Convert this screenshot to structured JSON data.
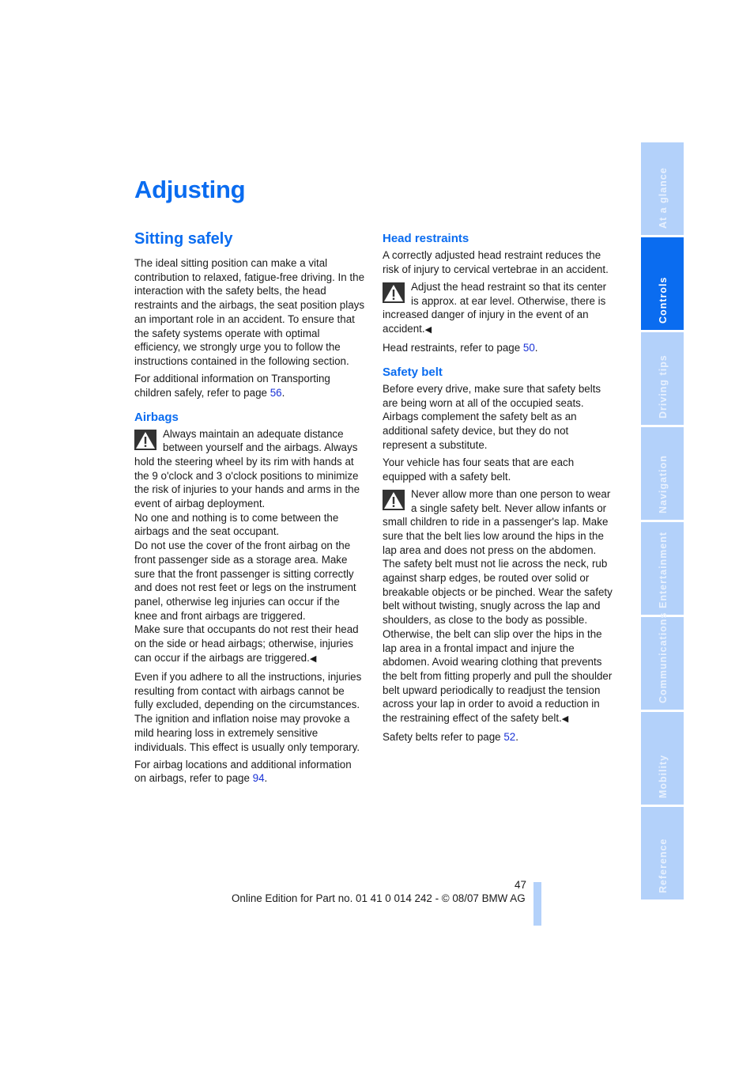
{
  "page": {
    "title": "Adjusting",
    "page_number": "47",
    "footer": "Online Edition for Part no. 01 41 0 014 242 - © 08/07 BMW AG"
  },
  "colors": {
    "accent": "#0a6cf0",
    "tab_inactive": "#b3d1fa",
    "link": "#1a33d6"
  },
  "left_column": {
    "heading": "Sitting safely",
    "intro": "The ideal sitting position can make a vital contribution to relaxed, fatigue-free driving. In the interaction with the safety belts, the head restraints and the airbags, the seat position plays an important role in an accident. To ensure that the safety systems operate with optimal efficiency, we strongly urge you to follow the instructions contained in the following section.",
    "child_ref": {
      "text": "For additional information on Transporting children safely, refer to page ",
      "page": "56",
      "suffix": "."
    },
    "airbags": {
      "heading": "Airbags",
      "warning_p1": "Always maintain an adequate distance between yourself and the airbags. Always hold the steering wheel by its rim with hands at the 9 o'clock and 3 o'clock positions to minimize the risk of injuries to your hands and arms in the event of airbag deployment.",
      "warning_p2": "No one and nothing is to come between the airbags and the seat occupant.",
      "warning_p3": "Do not use the cover of the front airbag on the front passenger side as a storage area. Make sure that the front passenger is sitting correctly and does not rest feet or legs on the instrument panel, otherwise leg injuries can occur if the knee and front airbags are triggered.",
      "warning_p4": "Make sure that occupants do not rest their head on the side or head airbags; otherwise, injuries can occur if the airbags are triggered.",
      "end_mark": "◀",
      "note": "Even if you adhere to all the instructions, injuries resulting from contact with airbags cannot be fully excluded, depending on the circumstances. The ignition and inflation noise may provoke a mild hearing loss in extremely sensitive individuals. This effect is usually only temporary.",
      "ref": {
        "text": "For airbag locations and additional information on airbags, refer to page ",
        "page": "94",
        "suffix": "."
      }
    }
  },
  "right_column": {
    "head_restraints": {
      "heading": "Head restraints",
      "intro": "A correctly adjusted head restraint reduces the risk of injury to cervical vertebrae in an accident.",
      "warning": "Adjust the head restraint so that its center is approx. at ear level. Otherwise, there is increased danger of injury in the event of an accident.",
      "end_mark": "◀",
      "ref": {
        "text": "Head restraints, refer to page ",
        "page": "50",
        "suffix": "."
      }
    },
    "safety_belt": {
      "heading": "Safety belt",
      "p1": "Before every drive, make sure that safety belts are being worn at all of the occupied seats. Airbags complement the safety belt as an additional safety device, but they do not represent a substitute.",
      "p2": "Your vehicle has four seats that are each equipped with a safety belt.",
      "warning": "Never allow more than one person to wear a single safety belt. Never allow infants or small children to ride in a passenger's lap. Make sure that the belt lies low around the hips in the lap area and does not press on the abdomen. The safety belt must not lie across the neck, rub against sharp edges, be routed over solid or breakable objects or be pinched. Wear the safety belt without twisting, snugly across the lap and shoulders, as close to the body as possible. Otherwise, the belt can slip over the hips in the lap area in a frontal impact and injure the abdomen. Avoid wearing clothing that prevents the belt from fitting properly and pull the shoulder belt upward periodically to readjust the tension across your lap in order to avoid a reduction in the restraining effect of the safety belt.",
      "end_mark": "◀",
      "ref": {
        "text": "Safety belts refer to page ",
        "page": "52",
        "suffix": "."
      }
    }
  },
  "side_tabs": [
    {
      "label": "At a glance",
      "active": false
    },
    {
      "label": "Controls",
      "active": true
    },
    {
      "label": "Driving tips",
      "active": false
    },
    {
      "label": "Navigation",
      "active": false
    },
    {
      "label": "Entertainment",
      "active": false
    },
    {
      "label": "Communications",
      "active": false
    },
    {
      "label": "Mobility",
      "active": false
    },
    {
      "label": "Reference",
      "active": false
    }
  ]
}
